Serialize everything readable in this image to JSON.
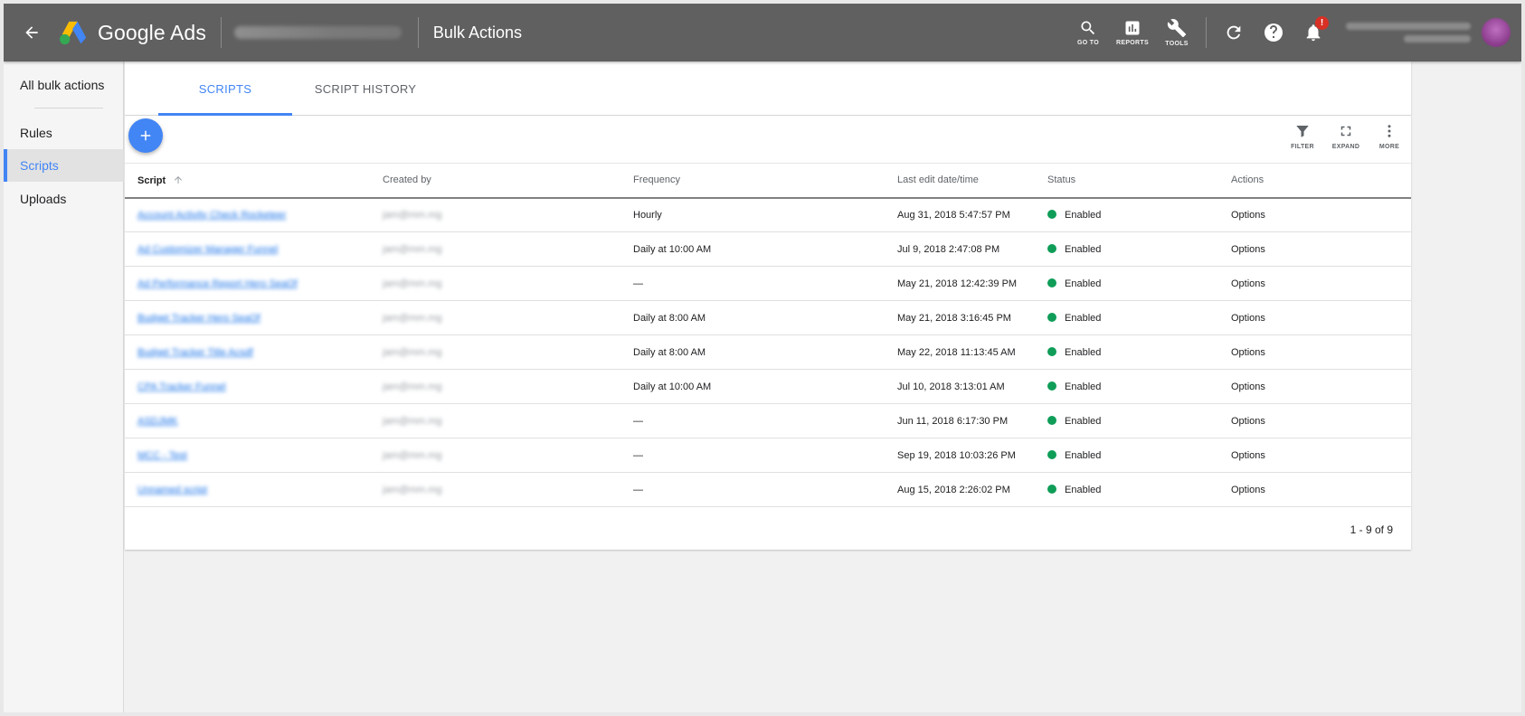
{
  "header": {
    "product_name": "Google Ads",
    "page_title": "Bulk Actions",
    "nav_buttons": [
      {
        "icon": "search-icon",
        "label": "GO TO"
      },
      {
        "icon": "bar-chart-icon",
        "label": "REPORTS"
      },
      {
        "icon": "wrench-icon",
        "label": "TOOLS"
      }
    ],
    "notification_badge": "!"
  },
  "sidebar": {
    "items": [
      {
        "label": "All bulk actions"
      },
      {
        "label": "Rules"
      },
      {
        "label": "Scripts",
        "active": true
      },
      {
        "label": "Uploads"
      }
    ]
  },
  "tabs": [
    {
      "label": "SCRIPTS",
      "active": true
    },
    {
      "label": "SCRIPT HISTORY"
    }
  ],
  "toolbar": {
    "filter": "FILTER",
    "expand": "EXPAND",
    "more": "MORE"
  },
  "table": {
    "columns": [
      "Script",
      "Created by",
      "Frequency",
      "Last edit date/time",
      "Status",
      "Actions"
    ],
    "rows": [
      {
        "script": "Account Activity Check Rocketeer",
        "created_by": "jam@mm.mg",
        "frequency": "Hourly",
        "last_edit": "Aug 31, 2018 5:47:57 PM",
        "status": "Enabled",
        "action": "Options"
      },
      {
        "script": "Ad Customizer Manager Funnel",
        "created_by": "jam@mm.mg",
        "frequency": "Daily at 10:00 AM",
        "last_edit": "Jul 9, 2018 2:47:08 PM",
        "status": "Enabled",
        "action": "Options"
      },
      {
        "script": "Ad Performance Report Hero SeaOf",
        "created_by": "jam@mm.mg",
        "frequency": "—",
        "last_edit": "May 21, 2018 12:42:39 PM",
        "status": "Enabled",
        "action": "Options"
      },
      {
        "script": "Budget Tracker Hero SeaOf",
        "created_by": "jam@mm.mg",
        "frequency": "Daily at 8:00 AM",
        "last_edit": "May 21, 2018 3:16:45 PM",
        "status": "Enabled",
        "action": "Options"
      },
      {
        "script": "Budget Tracker Title Acsdf",
        "created_by": "jam@mm.mg",
        "frequency": "Daily at 8:00 AM",
        "last_edit": "May 22, 2018 11:13:45 AM",
        "status": "Enabled",
        "action": "Options"
      },
      {
        "script": "CPA Tracker Funnel",
        "created_by": "jam@mm.mg",
        "frequency": "Daily at 10:00 AM",
        "last_edit": "Jul 10, 2018 3:13:01 AM",
        "status": "Enabled",
        "action": "Options"
      },
      {
        "script": "ASDJMK",
        "created_by": "jam@mm.mg",
        "frequency": "—",
        "last_edit": "Jun 11, 2018 6:17:30 PM",
        "status": "Enabled",
        "action": "Options"
      },
      {
        "script": "MCC - Test",
        "created_by": "jam@mm.mg",
        "frequency": "—",
        "last_edit": "Sep 19, 2018 10:03:26 PM",
        "status": "Enabled",
        "action": "Options"
      },
      {
        "script": "Unnamed script",
        "created_by": "jam@mm.mg",
        "frequency": "—",
        "last_edit": "Aug 15, 2018 2:26:02 PM",
        "status": "Enabled",
        "action": "Options"
      }
    ]
  },
  "pagination": "1 - 9 of 9",
  "colors": {
    "topbar": "#606060",
    "accent": "#4285f4",
    "status_enabled": "#0f9d58",
    "badge": "#d93025"
  }
}
